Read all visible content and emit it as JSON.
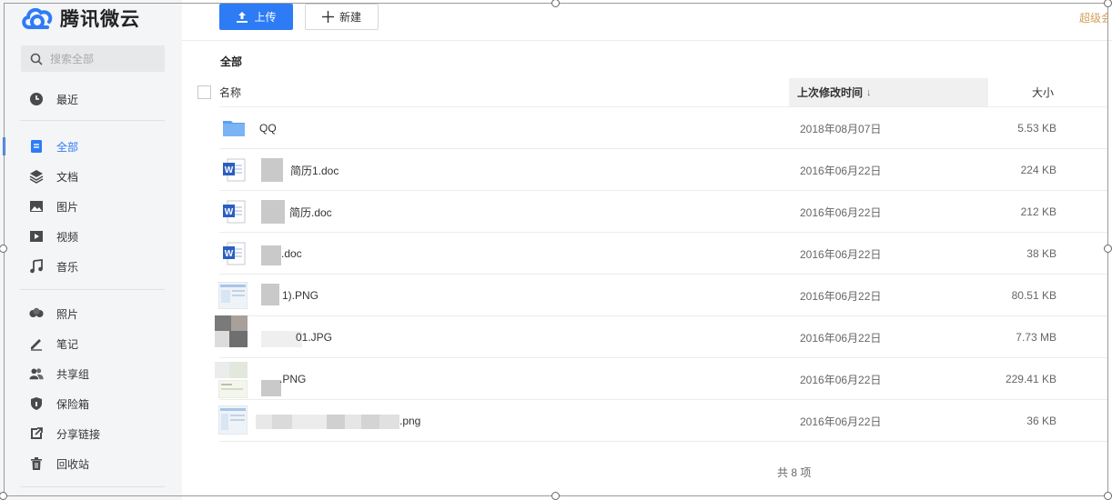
{
  "app": {
    "logo_text": "腾讯微云"
  },
  "sidebar": {
    "search_placeholder": "搜索全部",
    "items": [
      {
        "label": "最近",
        "icon": "clock-icon"
      },
      {
        "label": "全部",
        "icon": "all-files-icon",
        "active": true
      },
      {
        "label": "文档",
        "icon": "layers-icon"
      },
      {
        "label": "图片",
        "icon": "image-icon"
      },
      {
        "label": "视频",
        "icon": "video-icon"
      },
      {
        "label": "音乐",
        "icon": "music-icon"
      },
      {
        "label": "照片",
        "icon": "photo-icon"
      },
      {
        "label": "笔记",
        "icon": "pen-icon"
      },
      {
        "label": "共享组",
        "icon": "group-icon"
      },
      {
        "label": "保险箱",
        "icon": "shield-icon"
      },
      {
        "label": "分享链接",
        "icon": "share-link-icon"
      },
      {
        "label": "回收站",
        "icon": "trash-icon"
      }
    ]
  },
  "toolbar": {
    "upload_label": "上传",
    "new_label": "新建",
    "vip_label": "超级会"
  },
  "breadcrumb": "全部",
  "table": {
    "columns": {
      "name": "名称",
      "modified": "上次修改时间",
      "size": "大小"
    },
    "sort_indicator": "↓",
    "rows": [
      {
        "name": "QQ",
        "modified": "2018年08月07日",
        "size": "5.53 KB",
        "type": "folder"
      },
      {
        "name": "简历1.doc",
        "modified": "2016年06月22日",
        "size": "224 KB",
        "type": "word"
      },
      {
        "name": "简历.doc",
        "modified": "2016年06月22日",
        "size": "212 KB",
        "type": "word"
      },
      {
        "name": ".doc",
        "modified": "2016年06月22日",
        "size": "38 KB",
        "type": "word"
      },
      {
        "name": "1).PNG",
        "modified": "2016年06月22日",
        "size": "80.51 KB",
        "type": "image"
      },
      {
        "name": "01.JPG",
        "modified": "2016年06月22日",
        "size": "7.73 MB",
        "type": "image"
      },
      {
        "name": ".PNG",
        "modified": "2016年06月22日",
        "size": "229.41 KB",
        "type": "image"
      },
      {
        "name": ".png",
        "modified": "2016年06月22日",
        "size": "36 KB",
        "type": "image"
      }
    ],
    "footer": "共 8 项"
  },
  "colors": {
    "accent": "#2d7cf6",
    "sidebar_bg": "#f4f5f7",
    "folder": "#5aa0f0",
    "word": "#2b5fc1",
    "vip": "#d4a05c"
  }
}
